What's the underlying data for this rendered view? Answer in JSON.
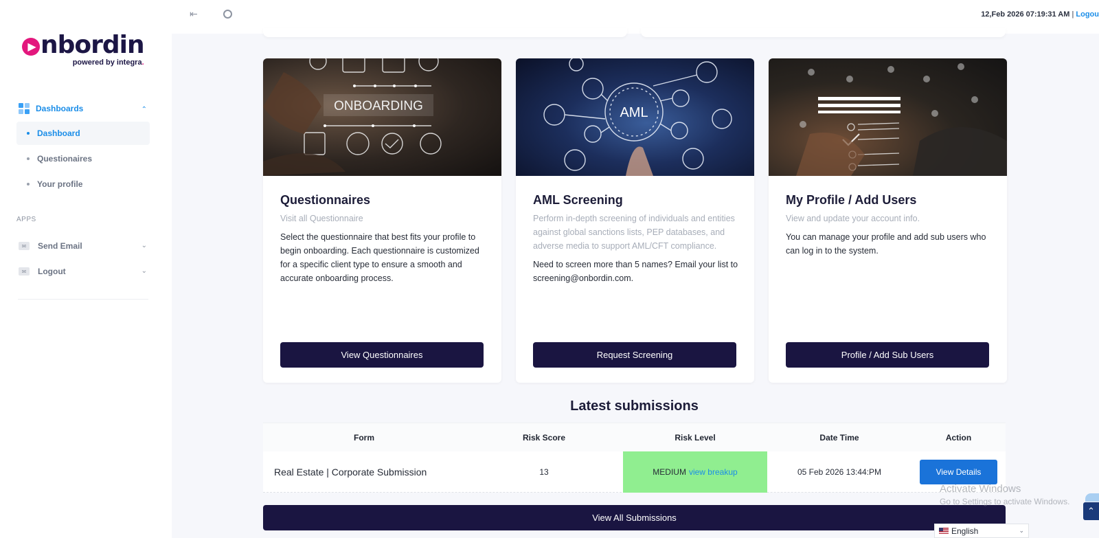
{
  "brand": {
    "logo_text": "nbordin",
    "logo_sub": "powered by integra",
    "colors": {
      "primary_navy": "#1a1541",
      "accent_pink": "#e3177d",
      "link_blue": "#1a8de8",
      "risk_medium_bg": "#90ee90"
    }
  },
  "topbar": {
    "datetime": "12,Feb 2026 07:19:31 AM",
    "separator": "|",
    "logout_link": "Logou",
    "icons": [
      "collapse-sidebar-icon",
      "circle-icon"
    ]
  },
  "sidebar": {
    "group": {
      "label": "Dashboards",
      "icon": "grid-icon"
    },
    "items": [
      {
        "label": "Dashboard",
        "active": true
      },
      {
        "label": "Questionaires",
        "active": false
      },
      {
        "label": "Your profile",
        "active": false
      }
    ],
    "apps_heading": "APPS",
    "apps": [
      {
        "label": "Send Email",
        "icon": "mail-icon"
      },
      {
        "label": "Logout",
        "icon": "mail-icon"
      }
    ]
  },
  "cards": [
    {
      "image_text": "ONBOARDING",
      "title": "Questionnaires",
      "subtitle": "Visit all Questionnaire",
      "body": "Select the questionnaire that best fits your profile to begin onboarding. Each questionnaire is customized for a specific client type to ensure a smooth and accurate onboarding process.",
      "button": "View Questionnaires"
    },
    {
      "image_text": "AML",
      "title": "AML Screening",
      "subtitle": "Perform in-depth screening of individuals and entities against global sanctions lists, PEP databases, and adverse media to support AML/CFT compliance.",
      "body": "Need to screen more than 5 names? Email your list to screening@onbordin.com.",
      "button": "Request Screening"
    },
    {
      "image_text": "",
      "title": "My Profile / Add Users",
      "subtitle": "View and update your account info.",
      "body": "You can manage your profile and add sub users who can log in to the system.",
      "button": "Profile / Add Sub Users"
    }
  ],
  "submissions": {
    "title": "Latest submissions",
    "columns": [
      "Form",
      "Risk Score",
      "Risk Level",
      "Date Time",
      "Action"
    ],
    "rows": [
      {
        "form": "Real Estate | Corporate Submission",
        "risk_score": "13",
        "risk_level": "MEDIUM",
        "risk_link": "view breakup",
        "datetime": "05 Feb 2026 13:44:PM",
        "action": "View Details"
      }
    ],
    "view_all": "View All Submissions"
  },
  "overlay": {
    "watermark_line1": "Activate Windows",
    "watermark_line2": "Go to Settings to activate Windows.",
    "language": "English"
  }
}
